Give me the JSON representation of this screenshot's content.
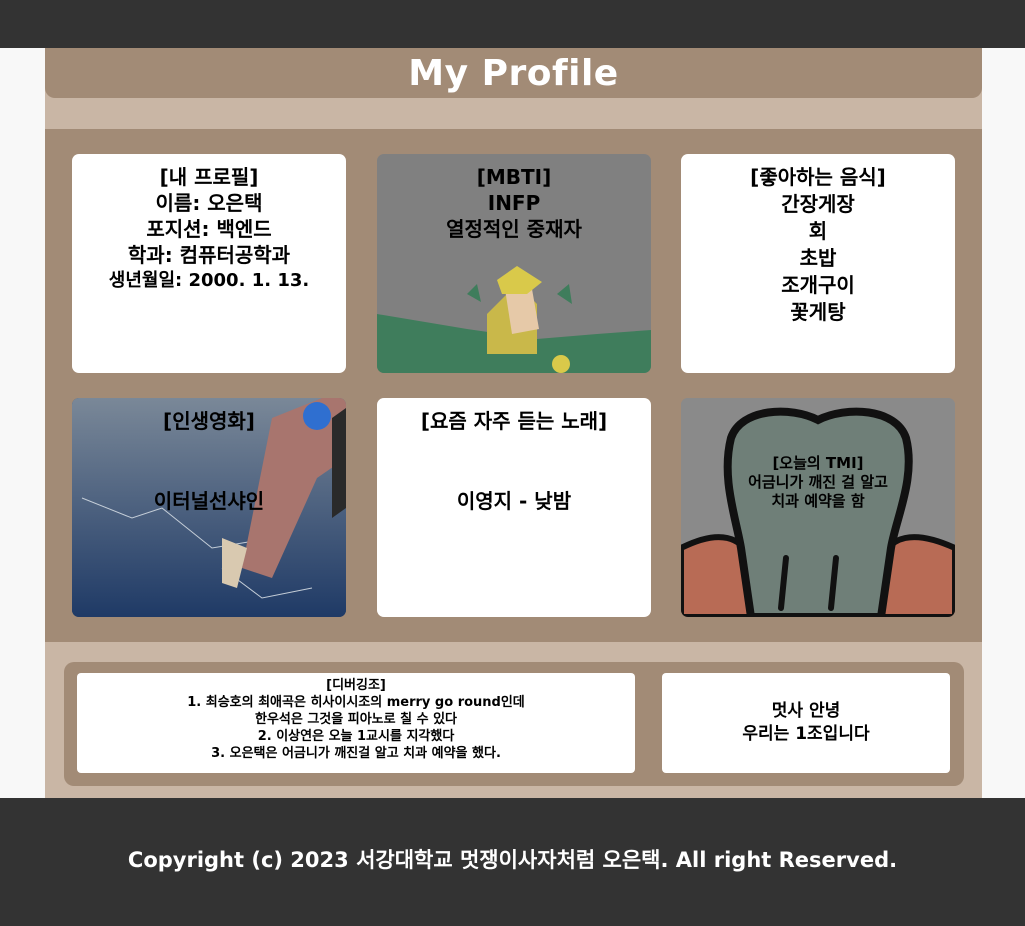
{
  "header": {
    "title": "My Profile"
  },
  "cards": {
    "profile": {
      "title": "[내 프로필]",
      "name": "이름: 오은택",
      "position": "포지션: 백엔드",
      "major": "학과: 컴퓨터공학과",
      "birth": "생년월일: 2000. 1. 13."
    },
    "mbti": {
      "title": "[MBTI]",
      "type": "INFP",
      "desc": "열정적인 중재자"
    },
    "food": {
      "title": "[좋아하는 음식]",
      "items": [
        "간장게장",
        "회",
        "초밥",
        "조개구이",
        "꽃게탕"
      ]
    },
    "movie": {
      "title": "[인생영화]",
      "name": "이터널선샤인"
    },
    "song": {
      "title": "[요즘 자주 듣는 노래]",
      "name": "이영지 - 낮밤"
    },
    "tmi": {
      "title": "[오늘의 TMI]",
      "line1": "어금니가 깨진 걸 알고",
      "line2": "치과 예약을 함"
    }
  },
  "notice": {
    "title": "[디버깅조]",
    "lines": [
      "1. 최승호의 최애곡은 히사이시조의 merry go round인데",
      "한우석은 그것을 피아노로 칠 수 있다",
      "2. 이상연은 오늘 1교시를 지각했다",
      "3. 오은택은 어금니가 깨진걸 알고 치과 예약을 했다."
    ]
  },
  "greeting": {
    "line1": "멋사 안녕",
    "line2": "우리는 1조입니다"
  },
  "footer": {
    "text": "Copyright (c) 2023 서강대학교 멋쟁이사자처럼 오은택. All right Reserved."
  },
  "colors": {
    "dark_bar": "#333333",
    "tan": "#a28b76",
    "light_tan": "#c9b6a5",
    "white": "#ffffff"
  }
}
